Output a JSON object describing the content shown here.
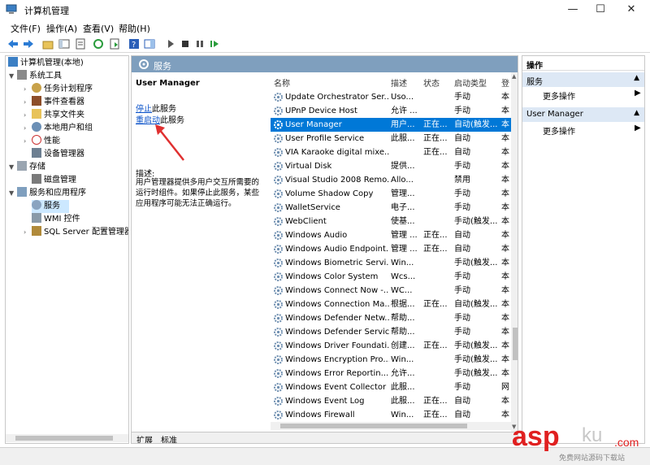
{
  "window": {
    "title": "计算机管理",
    "minimize": "—",
    "maximize": "☐",
    "close": "✕"
  },
  "menu": [
    "文件(F)",
    "操作(A)",
    "查看(V)",
    "帮助(H)"
  ],
  "tree": {
    "root": "计算机管理(本地)",
    "items": [
      {
        "label": "系统工具",
        "level": 1,
        "expanded": true
      },
      {
        "label": "任务计划程序",
        "level": 2
      },
      {
        "label": "事件查看器",
        "level": 2
      },
      {
        "label": "共享文件夹",
        "level": 2
      },
      {
        "label": "本地用户和组",
        "level": 2
      },
      {
        "label": "性能",
        "level": 2
      },
      {
        "label": "设备管理器",
        "level": 2
      },
      {
        "label": "存储",
        "level": 1,
        "expanded": true
      },
      {
        "label": "磁盘管理",
        "level": 2
      },
      {
        "label": "服务和应用程序",
        "level": 1,
        "expanded": true
      },
      {
        "label": "服务",
        "level": 2,
        "selected": true
      },
      {
        "label": "WMI 控件",
        "level": 2
      },
      {
        "label": "SQL Server 配置管理器",
        "level": 2
      }
    ]
  },
  "center": {
    "header": "服务",
    "detail": {
      "name": "User Manager",
      "stop_link": "停止",
      "stop_suffix": "此服务",
      "restart_link": "重启动",
      "restart_suffix": "此服务",
      "desc_label": "描述:",
      "description": "用户管理器提供多用户交互所需要的运行时组件。如果停止此服务，某些应用程序可能无法正确运行。"
    },
    "columns": [
      "名称",
      "描述",
      "状态",
      "启动类型",
      "登"
    ],
    "services": [
      {
        "name": "Update Orchestrator Ser...",
        "desc": "Uso...",
        "status": "",
        "startup": "手动",
        "logon": "本"
      },
      {
        "name": "UPnP Device Host",
        "desc": "允许 ...",
        "status": "",
        "startup": "手动",
        "logon": "本"
      },
      {
        "name": "User Manager",
        "desc": "用户...",
        "status": "正在...",
        "startup": "自动(触发...",
        "logon": "本",
        "selected": true
      },
      {
        "name": "User Profile Service",
        "desc": "此服...",
        "status": "正在...",
        "startup": "自动",
        "logon": "本"
      },
      {
        "name": "VIA Karaoke digital mixe...",
        "desc": "",
        "status": "正在...",
        "startup": "自动",
        "logon": "本"
      },
      {
        "name": "Virtual Disk",
        "desc": "提供...",
        "status": "",
        "startup": "手动",
        "logon": "本"
      },
      {
        "name": "Visual Studio 2008 Remo...",
        "desc": "Allo...",
        "status": "",
        "startup": "禁用",
        "logon": "本"
      },
      {
        "name": "Volume Shadow Copy",
        "desc": "管理...",
        "status": "",
        "startup": "手动",
        "logon": "本"
      },
      {
        "name": "WalletService",
        "desc": "电子...",
        "status": "",
        "startup": "手动",
        "logon": "本"
      },
      {
        "name": "WebClient",
        "desc": "使基...",
        "status": "",
        "startup": "手动(触发...",
        "logon": "本"
      },
      {
        "name": "Windows Audio",
        "desc": "管理 ...",
        "status": "正在...",
        "startup": "自动",
        "logon": "本"
      },
      {
        "name": "Windows Audio Endpoint...",
        "desc": "管理 ...",
        "status": "正在...",
        "startup": "自动",
        "logon": "本"
      },
      {
        "name": "Windows Biometric Servi...",
        "desc": "Win...",
        "status": "",
        "startup": "手动(触发...",
        "logon": "本"
      },
      {
        "name": "Windows Color System",
        "desc": "Wcs...",
        "status": "",
        "startup": "手动",
        "logon": "本"
      },
      {
        "name": "Windows Connect Now -...",
        "desc": "WC...",
        "status": "",
        "startup": "手动",
        "logon": "本"
      },
      {
        "name": "Windows Connection Ma...",
        "desc": "根据...",
        "status": "正在...",
        "startup": "自动(触发...",
        "logon": "本"
      },
      {
        "name": "Windows Defender Netw...",
        "desc": "帮助...",
        "status": "",
        "startup": "手动",
        "logon": "本"
      },
      {
        "name": "Windows Defender Service",
        "desc": "帮助...",
        "status": "",
        "startup": "手动",
        "logon": "本"
      },
      {
        "name": "Windows Driver Foundati...",
        "desc": "创建...",
        "status": "正在...",
        "startup": "手动(触发...",
        "logon": "本"
      },
      {
        "name": "Windows Encryption Pro...",
        "desc": "Win...",
        "status": "",
        "startup": "手动(触发...",
        "logon": "本"
      },
      {
        "name": "Windows Error Reportin...",
        "desc": "允许...",
        "status": "",
        "startup": "手动(触发...",
        "logon": "本"
      },
      {
        "name": "Windows Event Collector",
        "desc": "此服...",
        "status": "",
        "startup": "手动",
        "logon": "网"
      },
      {
        "name": "Windows Event Log",
        "desc": "此服...",
        "status": "正在...",
        "startup": "自动",
        "logon": "本"
      },
      {
        "name": "Windows Firewall",
        "desc": "Win...",
        "status": "正在...",
        "startup": "自动",
        "logon": "本"
      }
    ],
    "tabs": [
      "扩展",
      "标准"
    ]
  },
  "actions": {
    "title": "操作",
    "sections": [
      {
        "label": "服务",
        "item": "更多操作"
      },
      {
        "label": "User Manager",
        "item": "更多操作"
      }
    ]
  },
  "watermark": {
    "brand": "asp",
    "suffix": "ku",
    "sub": ".com",
    "caption": "免费网站源码下载站"
  },
  "colors": {
    "selection": "#0078d7",
    "panel_header": "#7f9fbe",
    "link": "#0a52c9",
    "annotation_arrow": "#e03030",
    "watermark": "#e02020"
  }
}
